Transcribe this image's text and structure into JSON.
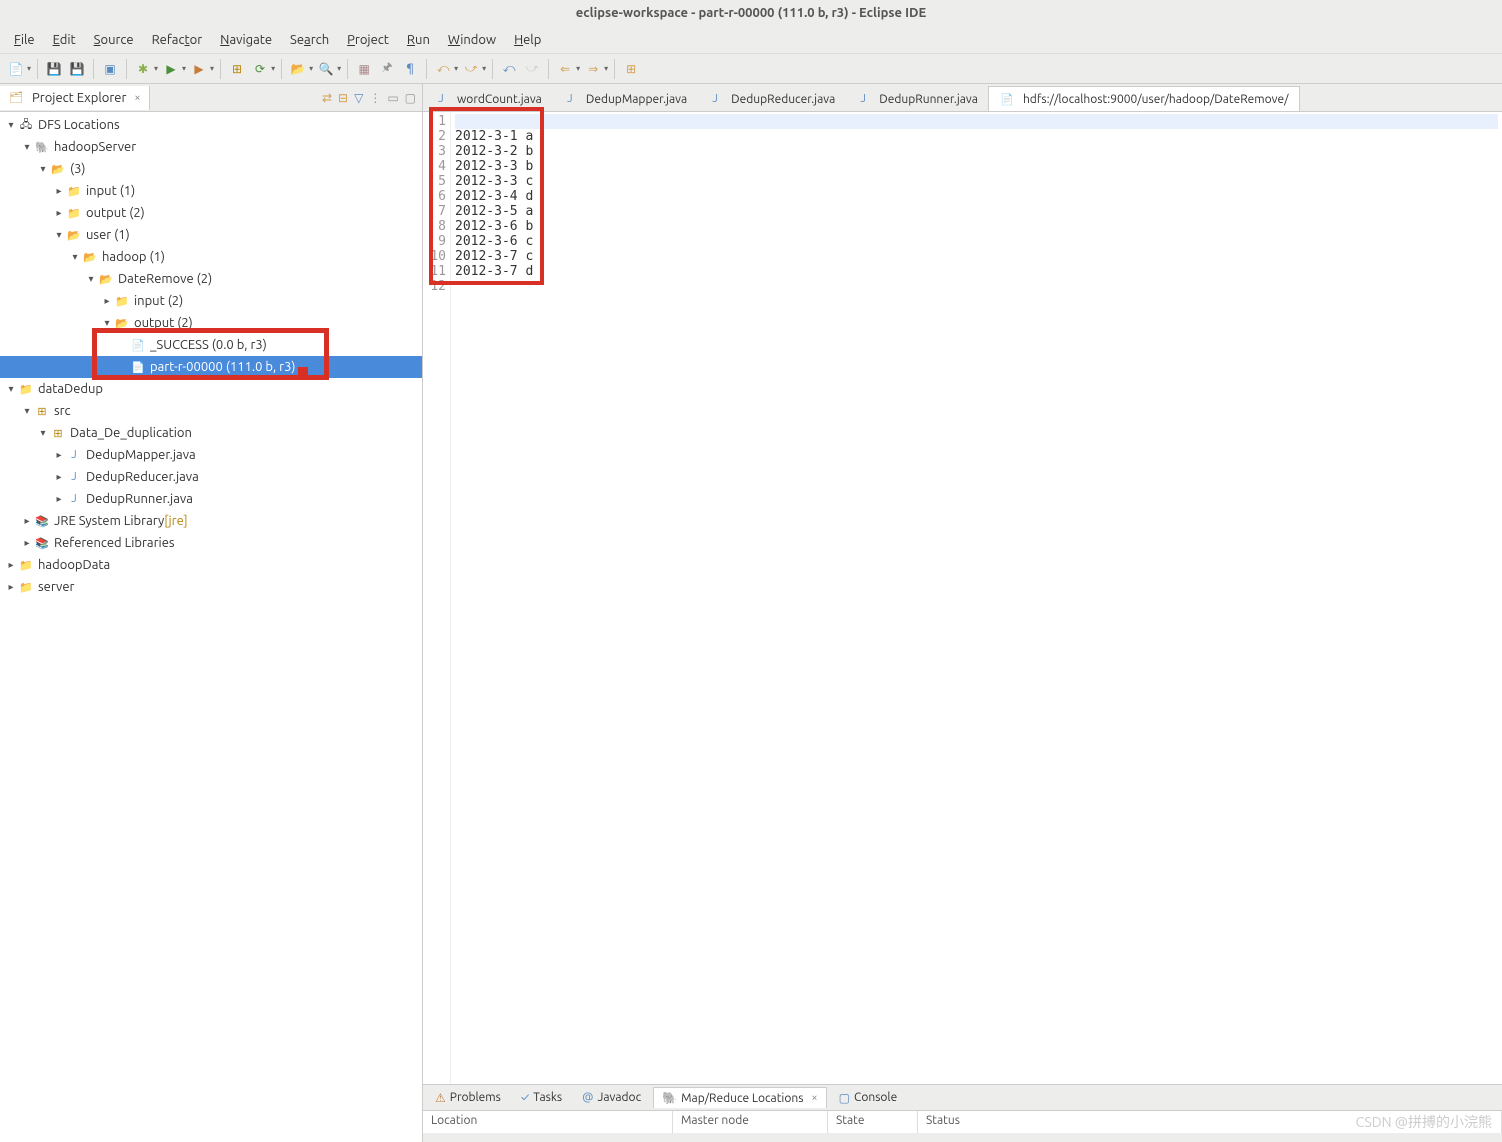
{
  "window_title": "eclipse-workspace - part-r-00000 (111.0 b, r3) - Eclipse IDE",
  "menus": [
    "File",
    "Edit",
    "Source",
    "Refactor",
    "Navigate",
    "Search",
    "Project",
    "Run",
    "Window",
    "Help"
  ],
  "explorer_title": "Project Explorer",
  "tree": {
    "dfs": "DFS Locations",
    "hadoopServer": "hadoopServer",
    "paren3": "(3)",
    "input1": "input (1)",
    "output2top": "output (2)",
    "user1": "user (1)",
    "hadoop1": "hadoop (1)",
    "dateremove2": "DateRemove (2)",
    "input2": "input (2)",
    "output2": "output (2)",
    "success": "_SUCCESS (0.0 b, r3)",
    "part": "part-r-00000 (111.0 b, r3)",
    "dataDedup": "dataDedup",
    "src": "src",
    "pkg": "Data_De_duplication",
    "mapper": "DedupMapper.java",
    "reducer": "DedupReducer.java",
    "runner": "DedupRunner.java",
    "jre": "JRE System Library",
    "jre_note": "[jre]",
    "reflibs": "Referenced Libraries",
    "hadoopData": "hadoopData",
    "server": "server"
  },
  "editor_tabs": [
    {
      "label": "wordCount.java",
      "icon": "java"
    },
    {
      "label": "DedupMapper.java",
      "icon": "java"
    },
    {
      "label": "DedupReducer.java",
      "icon": "java"
    },
    {
      "label": "DedupRunner.java",
      "icon": "java"
    },
    {
      "label": "hdfs://localhost:9000/user/hadoop/DateRemove/",
      "icon": "file",
      "active": true
    }
  ],
  "editor_lines": [
    "",
    "2012-3-1 a",
    "2012-3-2 b",
    "2012-3-3 b",
    "2012-3-3 c",
    "2012-3-4 d",
    "2012-3-5 a",
    "2012-3-6 b",
    "2012-3-6 c",
    "2012-3-7 c",
    "2012-3-7 d",
    ""
  ],
  "bottom_tabs": [
    {
      "label": "Problems",
      "icon": "⚠"
    },
    {
      "label": "Tasks",
      "icon": "✓"
    },
    {
      "label": "Javadoc",
      "icon": "@"
    },
    {
      "label": "Map/Reduce Locations",
      "icon": "🐘",
      "active": true
    },
    {
      "label": "Console",
      "icon": "▢"
    }
  ],
  "bottom_headers": [
    "Location",
    "Master node",
    "State",
    "Status"
  ],
  "watermark": "CSDN @拼搏的小浣熊"
}
